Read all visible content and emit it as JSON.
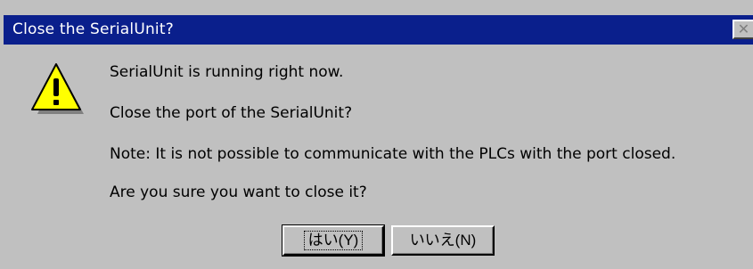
{
  "dialog": {
    "title": "Close the SerialUnit?",
    "close_glyph": "✕",
    "icon": "warning-icon",
    "messages": [
      "SerialUnit is running right now.",
      "Close the port of the SerialUnit?",
      "Note: It is not possible to communicate with the PLCs with the port closed.",
      "Are you sure you want to close it?"
    ],
    "buttons": {
      "yes_label": "はい(Y)",
      "no_label": "いいえ(N)"
    }
  },
  "colors": {
    "titlebar": "#0a1f8c",
    "face": "#c0c0c0",
    "warning_fill": "#ffff00"
  }
}
